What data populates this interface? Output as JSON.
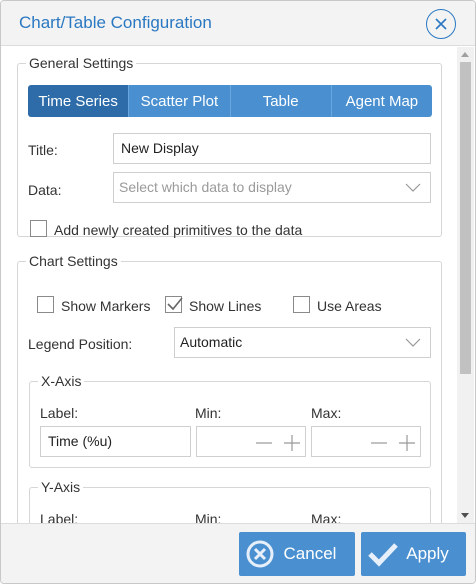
{
  "dialog": {
    "title": "Chart/Table Configuration",
    "close_icon": "close-circle-icon"
  },
  "general": {
    "legend": "General Settings",
    "tabs": [
      {
        "label": "Time Series",
        "active": true
      },
      {
        "label": "Scatter Plot",
        "active": false
      },
      {
        "label": "Table",
        "active": false
      },
      {
        "label": "Agent Map",
        "active": false
      }
    ],
    "title_label": "Title:",
    "title_value": "New Display",
    "data_label": "Data:",
    "data_placeholder": "Select which data to display",
    "add_primitives_label": "Add newly created primitives to the data",
    "add_primitives_checked": false
  },
  "chart": {
    "legend": "Chart Settings",
    "show_markers_label": "Show Markers",
    "show_markers_checked": false,
    "show_lines_label": "Show Lines",
    "show_lines_checked": true,
    "use_areas_label": "Use Areas",
    "use_areas_checked": false,
    "legend_position_label": "Legend Position:",
    "legend_position_value": "Automatic",
    "x_axis": {
      "legend": "X-Axis",
      "label_label": "Label:",
      "label_value": "Time (%u)",
      "min_label": "Min:",
      "max_label": "Max:"
    },
    "y_axis": {
      "legend": "Y-Axis",
      "label_label": "Label:",
      "min_label": "Min:",
      "max_label": "Max:"
    }
  },
  "footer": {
    "cancel_label": "Cancel",
    "apply_label": "Apply"
  },
  "colors": {
    "accent": "#4a90d0",
    "accent_dark": "#2d6ca9",
    "title_blue": "#2a78c2"
  }
}
